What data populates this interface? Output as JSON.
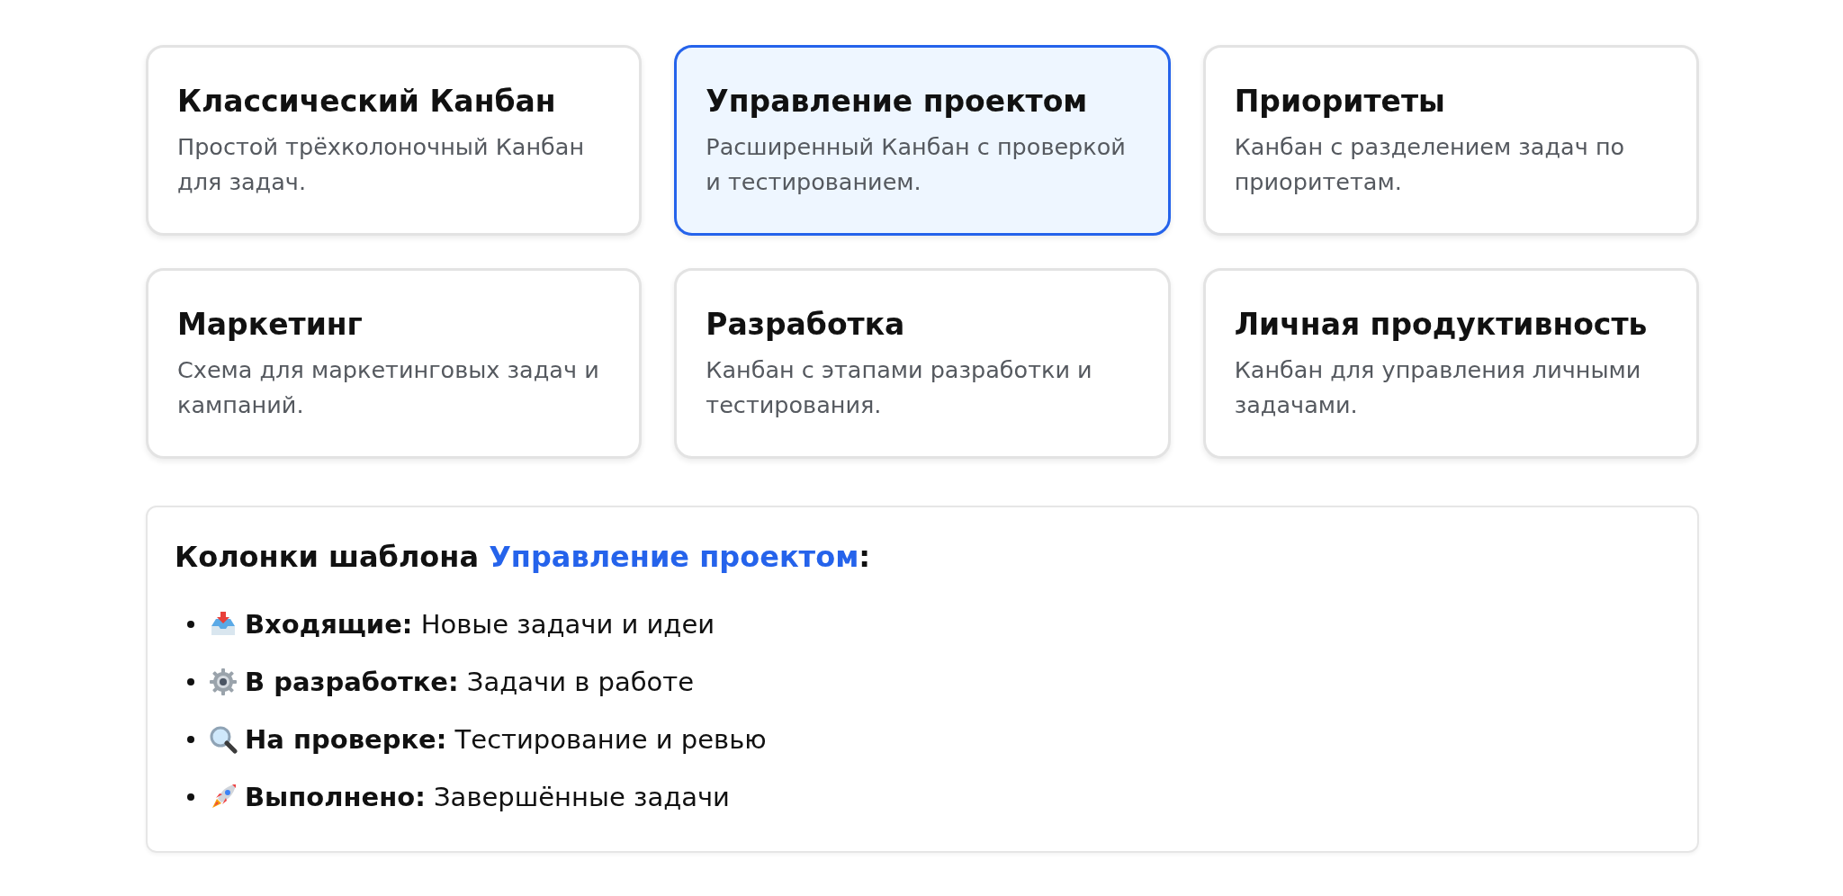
{
  "templates": [
    {
      "title": "Классический Канбан",
      "description": "Простой трёхколоночный Канбан для задач.",
      "selected": false
    },
    {
      "title": "Управление проектом",
      "description": "Расширенный Канбан с проверкой и тестированием.",
      "selected": true
    },
    {
      "title": "Приоритеты",
      "description": "Канбан с разделением задач по приоритетам.",
      "selected": false
    },
    {
      "title": "Маркетинг",
      "description": "Схема для маркетинговых задач и кампаний.",
      "selected": false
    },
    {
      "title": "Разработка",
      "description": "Канбан с этапами разработки и тестирования.",
      "selected": false
    },
    {
      "title": "Личная продуктивность",
      "description": "Канбан для управления личными задачами.",
      "selected": false
    }
  ],
  "columns_panel": {
    "heading_before": "Колонки шаблона ",
    "heading_highlight": "Управление проектом",
    "heading_after": ":",
    "columns": [
      {
        "kind": "inbox",
        "text": "**Входящие:** Новые задачи и идеи"
      },
      {
        "kind": "gear",
        "text": "**В разработке:** Задачи в работе"
      },
      {
        "kind": "magnifier",
        "text": "**На проверке:** Тестирование и ревью"
      },
      {
        "kind": "rocket",
        "text": "**Выполнено:** Завершённые задачи"
      }
    ]
  }
}
